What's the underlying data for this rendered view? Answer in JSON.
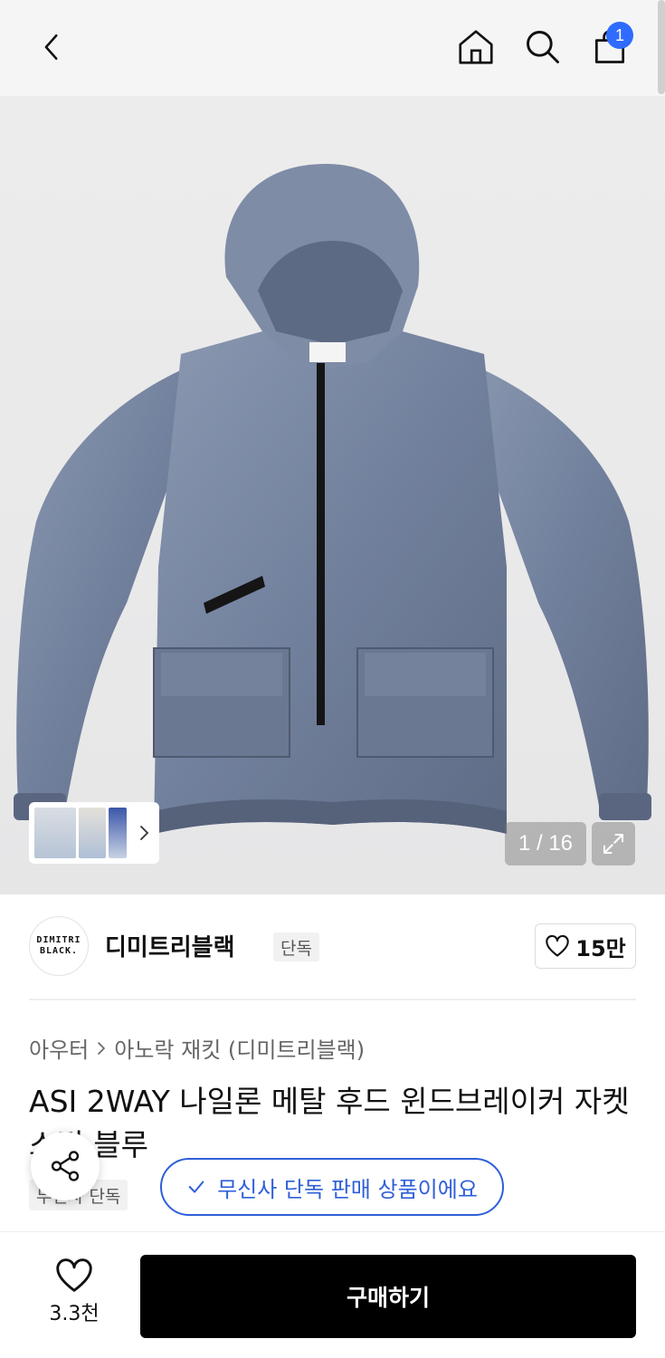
{
  "header": {
    "back_icon": "chevron-left-icon",
    "home_icon": "home-icon",
    "search_icon": "search-icon",
    "cart_icon": "shopping-bag-icon",
    "cart_count": "1",
    "badge_color": "#2f6bff"
  },
  "gallery": {
    "counter": "1 / 16",
    "expand_icon": "expand-icon"
  },
  "brand": {
    "logo_line1": "DIMITRI",
    "logo_line2": "BLACK.",
    "name": "디미트리블랙",
    "tag": "단독",
    "like_count": "15만"
  },
  "breadcrumb": {
    "level1": "아우터",
    "level2": "아노락 재킷 (디미트리블랙)"
  },
  "product": {
    "title": "ASI 2WAY 나일론 메탈 후드 윈드브레이커 자켓 스틸 블루",
    "tag": "무신사 단독",
    "exclusive_label": "무신사 단독 판매 상품이에요",
    "accent_color": "#2f5fd8"
  },
  "bottom": {
    "wish_count": "3.3천",
    "buy_label": "구매하기"
  }
}
